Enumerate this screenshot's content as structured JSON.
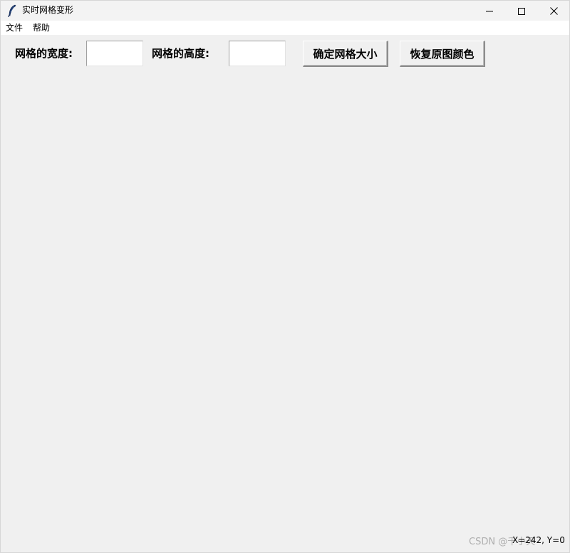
{
  "window": {
    "title": "实时网格变形",
    "icon": "feather-icon"
  },
  "menu": {
    "items": [
      {
        "label": "文件"
      },
      {
        "label": "帮助"
      }
    ]
  },
  "toolbar": {
    "width_label": "网格的宽度:",
    "width_value": "",
    "height_label": "网格的高度:",
    "height_value": "",
    "confirm_label": "确定网格大小",
    "restore_label": "恢复原图颜色"
  },
  "status": {
    "coords": "X=242, Y=0"
  },
  "watermark": {
    "text": "CSDN @千小天"
  },
  "colors": {
    "background": "#f0f0f0",
    "titlebar": "#f3f3f3",
    "menubar": "#ffffff"
  }
}
